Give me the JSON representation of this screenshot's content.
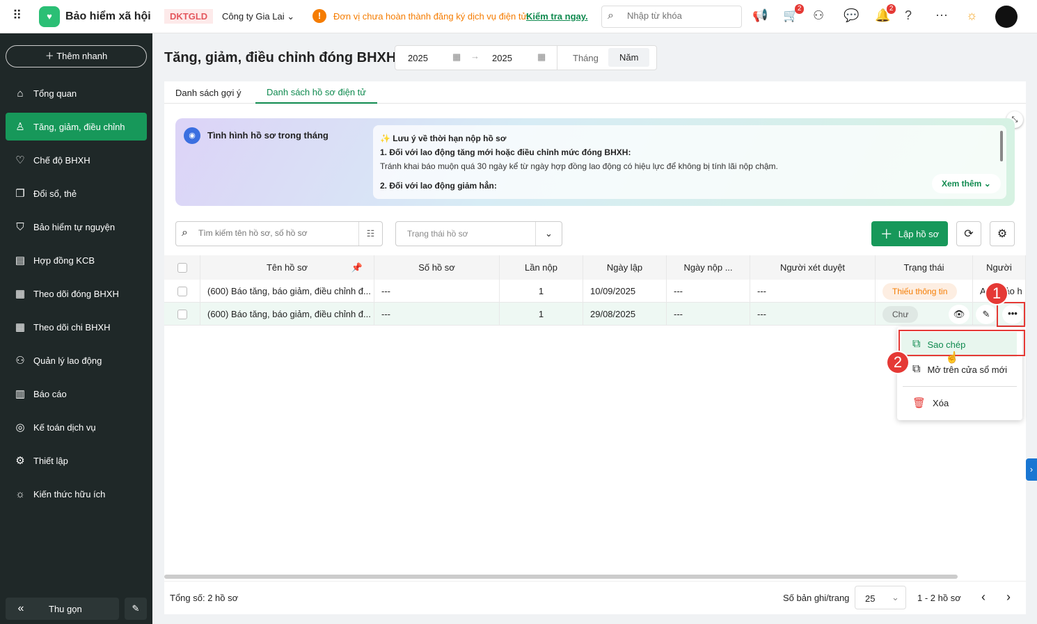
{
  "topbar": {
    "app_title": "Bảo hiểm xã hội",
    "company_code": "DKTGLD",
    "company_name": "Công ty Gia Lai",
    "warning_text": "Đơn vị chưa hoàn thành đăng ký dịch vụ điện tử.",
    "warning_link": "Kiểm tra ngay.",
    "search_placeholder": "Nhập từ khóa",
    "cart_count": "2",
    "notif_count": "2"
  },
  "sidebar": {
    "quick_add": "Thêm nhanh",
    "items": [
      {
        "label": "Tổng quan",
        "icon": "⌂"
      },
      {
        "label": "Tăng, giảm, điều chỉnh",
        "icon": "♙"
      },
      {
        "label": "Chế độ BHXH",
        "icon": "♡"
      },
      {
        "label": "Đổi sổ, thẻ",
        "icon": "❐"
      },
      {
        "label": "Bảo hiểm tự nguyện",
        "icon": "⛉"
      },
      {
        "label": "Hợp đồng KCB",
        "icon": "▤"
      },
      {
        "label": "Theo dõi đóng BHXH",
        "icon": "▦"
      },
      {
        "label": "Theo dõi chi BHXH",
        "icon": "▦"
      },
      {
        "label": "Quản lý lao động",
        "icon": "⚇"
      },
      {
        "label": "Báo cáo",
        "icon": "▥"
      },
      {
        "label": "Kế toán dịch vụ",
        "icon": "◎"
      },
      {
        "label": "Thiết lập",
        "icon": "⚙"
      },
      {
        "label": "Kiến thức hữu ích",
        "icon": "☼"
      }
    ],
    "collapse": "Thu gọn"
  },
  "page": {
    "title": "Tăng, giảm, điều chỉnh đóng BHXH",
    "year_from": "2025",
    "year_to": "2025",
    "period_month": "Tháng",
    "period_year": "Năm",
    "tabs": [
      "Danh sách gợi ý",
      "Danh sách hồ sơ điện tử"
    ]
  },
  "notice": {
    "title": "Tình hình hồ sơ trong tháng",
    "heading": "Lưu ý về thời hạn nộp hồ sơ",
    "item1_title": "1. Đối với lao động tăng mới hoặc điều chỉnh mức đóng BHXH:",
    "item1_text": "Tránh khai báo muộn quá 30 ngày kể từ ngày hợp đồng lao động có hiệu lực để không bị tính lãi nộp chậm.",
    "item2_title": "2. Đối với lao động giảm hẳn:",
    "more": "Xem thêm"
  },
  "filters": {
    "search_placeholder": "Tìm kiếm tên hồ sơ, số hồ sơ",
    "status_placeholder": "Trạng thái hồ sơ",
    "create": "Lập hồ sơ"
  },
  "table": {
    "headers": [
      "Tên hồ sơ",
      "Số hồ sơ",
      "Lần nộp",
      "Ngày lập",
      "Ngày nộp ...",
      "Người xét duyệt",
      "Trạng thái",
      "Người"
    ],
    "rows": [
      {
        "name": "(600) Báo tăng, báo giảm, điều chỉnh đ...",
        "number": "---",
        "attempt": "1",
        "created": "10/09/2025",
        "submitted": "---",
        "reviewer": "---",
        "status": "Thiếu thông tin",
        "creator": "Anh Bảo h"
      },
      {
        "name": "(600) Báo tăng, báo giảm, điều chỉnh đ...",
        "number": "---",
        "attempt": "1",
        "created": "29/08/2025",
        "submitted": "---",
        "reviewer": "---",
        "status": "Chư",
        "creator": ""
      }
    ]
  },
  "menu": {
    "copy": "Sao chép",
    "open_new": "Mở trên cửa sổ mới",
    "delete": "Xóa"
  },
  "callouts": [
    "1",
    "2"
  ],
  "footer": {
    "total": "Tổng số: 2 hồ sơ",
    "per_page_label": "Số bản ghi/trang",
    "per_page": "25",
    "range": "1 - 2 hồ sơ"
  }
}
